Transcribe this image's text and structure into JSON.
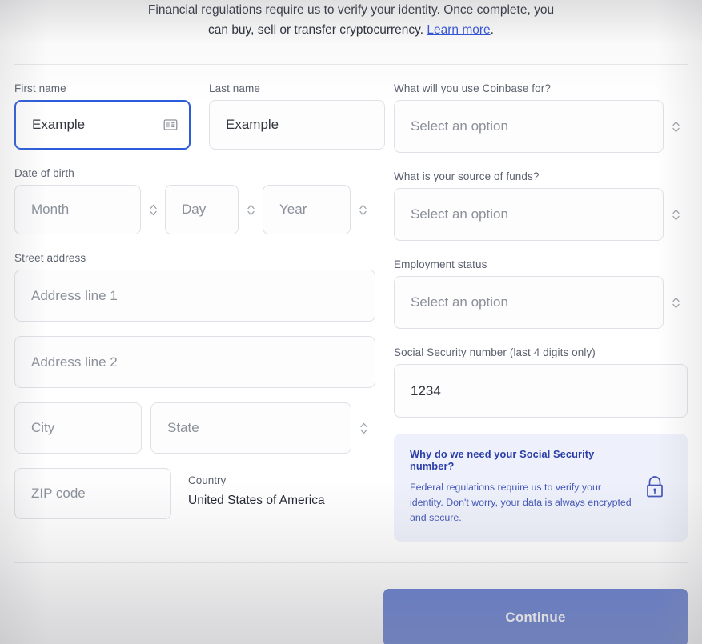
{
  "notice": {
    "line1": "Financial regulations require us to verify your identity. Once complete, you",
    "line2": "can buy, sell or transfer cryptocurrency.",
    "link": "Learn more",
    "period": "."
  },
  "form": {
    "first_name": {
      "label": "First name",
      "value": "Example",
      "icon": "contact-card-icon"
    },
    "last_name": {
      "label": "Last name",
      "value": "Example"
    },
    "date_of_birth": {
      "label": "Date of birth",
      "month_placeholder": "Month",
      "day_placeholder": "Day",
      "year_placeholder": "Year"
    },
    "street_address": {
      "label": "Street address",
      "line1_placeholder": "Address line 1",
      "line2_placeholder": "Address line 2"
    },
    "city_placeholder": "City",
    "state_placeholder": "State",
    "zip_placeholder": "ZIP code",
    "country": {
      "label": "Country",
      "value": "United States of America"
    },
    "use_for": {
      "label": "What will you use Coinbase for?",
      "placeholder": "Select an option"
    },
    "source_of_funds": {
      "label": "What is your source of funds?",
      "placeholder": "Select an option"
    },
    "employment_status": {
      "label": "Employment status",
      "placeholder": "Select an option"
    },
    "ssn": {
      "label": "Social Security number (last 4 digits only)",
      "value": "1234"
    }
  },
  "callout": {
    "title": "Why do we need your Social Security number?",
    "body": "Federal regulations require us to verify your identity. Don't worry, your data is always encrypted and secure.",
    "icon": "lock-icon"
  },
  "footer": {
    "continue_label": "Continue"
  },
  "colors": {
    "link": "#2b4ddb",
    "focus_border": "#2b5cd9",
    "callout_bg": "#eef1fb",
    "callout_text": "#4356b8",
    "callout_title": "#2b3ea8",
    "button_bg": "#5a74cc",
    "placeholder": "#8b9099",
    "label": "#5b616e",
    "field_border": "#dfe1e6"
  }
}
